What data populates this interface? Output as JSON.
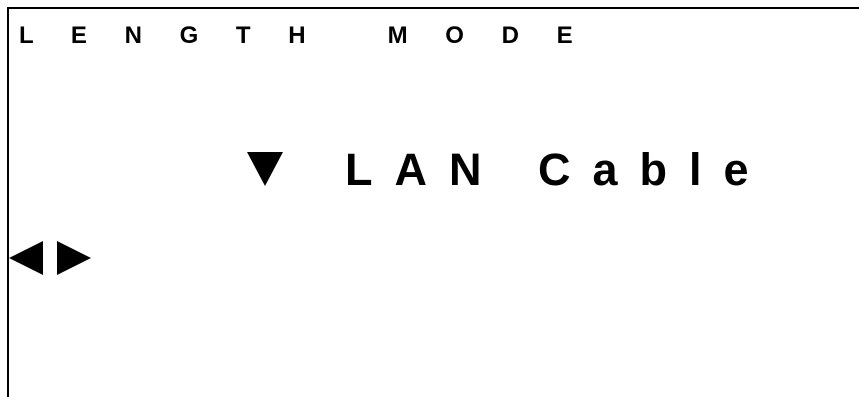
{
  "screen": {
    "title": "L E N G T H   M O D E",
    "selection": {
      "indicator_icon": "down-triangle-icon",
      "value": "LAN Cable"
    },
    "navigation": {
      "prev_icon": "left-triangle-icon",
      "next_icon": "right-triangle-icon"
    }
  }
}
